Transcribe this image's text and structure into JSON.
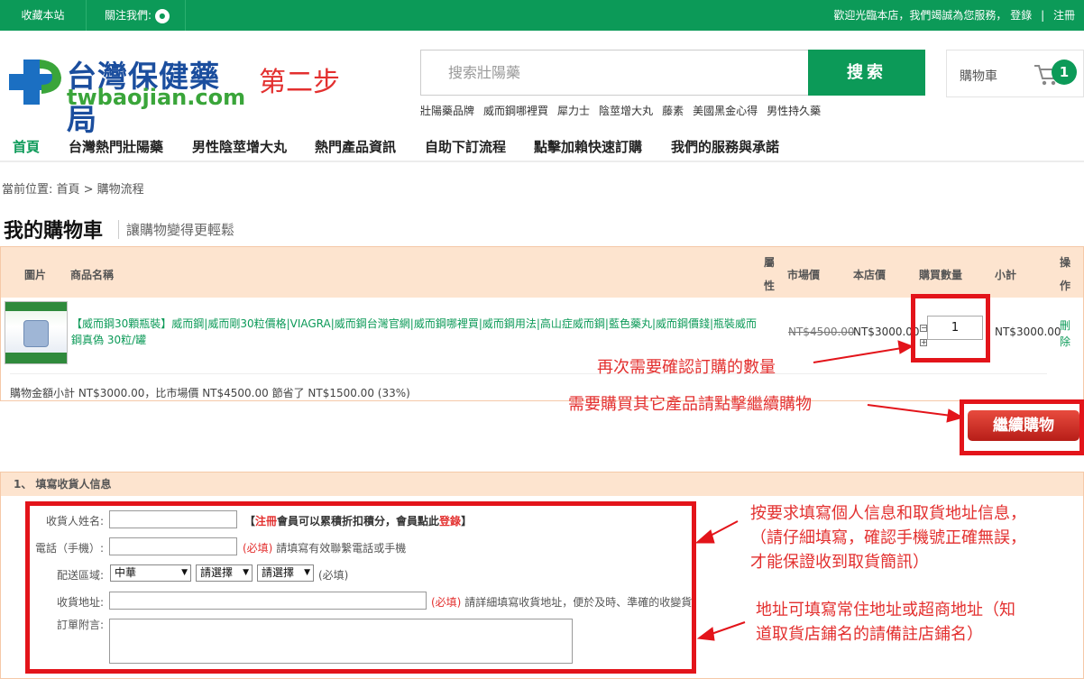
{
  "topbar": {
    "favorite": "收藏本站",
    "follow": "關注我們:",
    "line_icon": "LINE",
    "welcome": "歡迎光臨本店，我們竭誠為您服務，",
    "login": "登錄",
    "sep": "|",
    "register": "注冊"
  },
  "header": {
    "logo_zh": "台灣保健藥局",
    "logo_en": "twbaojian.com",
    "step_label": "第二步",
    "search_placeholder": "搜索壯陽藥",
    "search_button": "搜索",
    "hot_keywords": [
      "壯陽藥品牌",
      "威而鋼哪裡買",
      "犀力士",
      "陰莖增大丸",
      "藤素",
      "美國黑金心得",
      "男性持久藥"
    ],
    "cart_label": "購物車",
    "cart_count": "1"
  },
  "nav": [
    "首頁",
    "台灣熱門壯陽藥",
    "男性陰莖增大丸",
    "熱門產品資訊",
    "自助下訂流程",
    "點擊加賴快速訂購",
    "我們的服務與承諾"
  ],
  "breadcrumb": "當前位置: 首頁 > 購物流程",
  "page": {
    "title": "我的購物車",
    "subtitle": "讓購物變得更輕鬆"
  },
  "cart_table": {
    "headers": {
      "image": "圖片",
      "name": "商品名稱",
      "attr_1": "屬",
      "attr_2": "性",
      "market_price": "市場價",
      "shop_price": "本店價",
      "qty": "購買數量",
      "subtotal": "小計",
      "op_1": "操",
      "op_2": "作"
    },
    "item": {
      "name": "【威而鋼30顆瓶裝】威而鋼|威而剛30粒價格|VIAGRA|威而鋼台灣官網|威而鋼哪裡買|威而鋼用法|高山症威而鋼|藍色藥丸|威而鋼價錢|瓶裝威而鋼真偽 30粒/罐",
      "market_price": "NT$4500.00",
      "shop_price": "NT$3000.00",
      "qty": "1",
      "subtotal": "NT$3000.00",
      "delete_1": "刪",
      "delete_2": "除"
    },
    "summary": "購物金額小計 NT$3000.00，比市場價 NT$4500.00 節省了 NT$1500.00 (33%)"
  },
  "annotations": {
    "confirm_qty": "再次需要確認訂購的數量",
    "continue_hint": "需要購買其它產品請點擊繼續購物",
    "fill_info_1": "按要求填寫個人信息和取貨地址信息，",
    "fill_info_2": "（請仔細填寫，確認手機號正確無誤，",
    "fill_info_3": "才能保證收到取貨簡訊）",
    "address_hint_1": "地址可填寫常住地址或超商地址（知",
    "address_hint_2": "道取貨店鋪名的請備註店鋪名）"
  },
  "continue_button": "繼續購物",
  "address_form": {
    "section_title": "1、 填寫收貨人信息",
    "name_label": "收貨人姓名:",
    "name_note_open": "【",
    "name_note_register": "注冊",
    "name_note_mid": "會員可以累積折扣積分，會員點此",
    "name_note_login": "登錄",
    "name_note_close": "】",
    "phone_label": "電話（手機）:",
    "required": "(必填)",
    "phone_hint": "請填寫有效聯繫電話或手機",
    "region_label": "配送區域:",
    "region_country": "中華",
    "region_select": "請選擇",
    "address_label": "收貨地址:",
    "address_hint": "請詳細填寫收貨地址，便於及時、準確的收變貨",
    "note_label": "訂單附言:"
  },
  "colors": {
    "brand_green": "#0c9a58",
    "annotation_red": "#e3302f",
    "table_header_bg": "#fde4cf"
  }
}
